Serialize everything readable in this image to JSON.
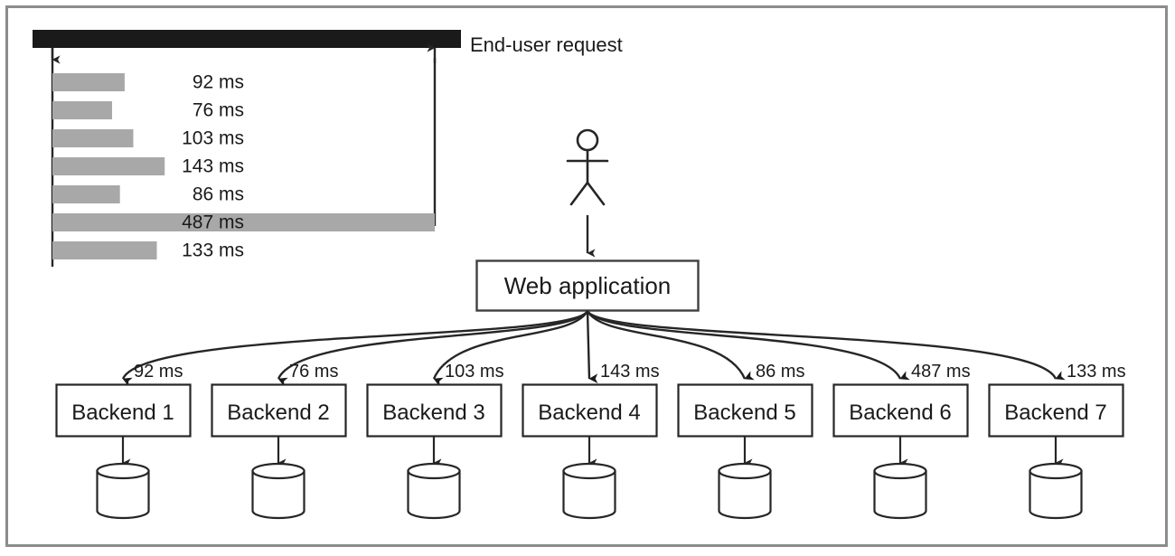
{
  "figure": {
    "title_label": "End-user request",
    "actor_label": "user-actor",
    "web_application_label": "Web application",
    "unit": "ms",
    "colors": {
      "frame": "#8c8c8c",
      "total_bar": "#1a1a1a",
      "segment_bar": "#a8a8a8",
      "stroke": "#262626",
      "text": "#1a1a1a",
      "background": "#ffffff"
    },
    "timeline": {
      "total_bar_label": "End-user request",
      "total_ms": 487,
      "rows": [
        {
          "label": "92 ms",
          "value": 92
        },
        {
          "label": "76 ms",
          "value": 76
        },
        {
          "label": "103 ms",
          "value": 103
        },
        {
          "label": "143 ms",
          "value": 143
        },
        {
          "label": "86 ms",
          "value": 86
        },
        {
          "label": "487 ms",
          "value": 487
        },
        {
          "label": "133 ms",
          "value": 133
        }
      ]
    },
    "backends": [
      {
        "name": "Backend 1",
        "latency_label": "92 ms",
        "latency_ms": 92
      },
      {
        "name": "Backend 2",
        "latency_label": "76 ms",
        "latency_ms": 76
      },
      {
        "name": "Backend 3",
        "latency_label": "103 ms",
        "latency_ms": 103
      },
      {
        "name": "Backend 4",
        "latency_label": "143 ms",
        "latency_ms": 143
      },
      {
        "name": "Backend 5",
        "latency_label": "86 ms",
        "latency_ms": 86
      },
      {
        "name": "Backend 6",
        "latency_label": "487 ms",
        "latency_ms": 487
      },
      {
        "name": "Backend 7",
        "latency_label": "133 ms",
        "latency_ms": 133
      }
    ],
    "databases": [
      {
        "name": "database-1"
      },
      {
        "name": "database-2"
      },
      {
        "name": "database-3"
      },
      {
        "name": "database-4"
      },
      {
        "name": "database-5"
      },
      {
        "name": "database-6"
      },
      {
        "name": "database-7"
      }
    ]
  },
  "chart_data": {
    "type": "bar",
    "title": "End-user request",
    "xlabel": "",
    "ylabel": "",
    "orientation": "horizontal",
    "unit": "ms",
    "categories": [
      "Backend 1",
      "Backend 2",
      "Backend 3",
      "Backend 4",
      "Backend 5",
      "Backend 6",
      "Backend 7"
    ],
    "values": [
      92,
      76,
      103,
      143,
      86,
      487,
      133
    ],
    "data_labels": [
      "92 ms",
      "76 ms",
      "103 ms",
      "143 ms",
      "86 ms",
      "487 ms",
      "133 ms"
    ],
    "xlim": [
      0,
      487
    ],
    "total_request_ms": 487,
    "grid": false,
    "legend": false,
    "annotations": [
      "End-user request",
      "Web application"
    ]
  }
}
